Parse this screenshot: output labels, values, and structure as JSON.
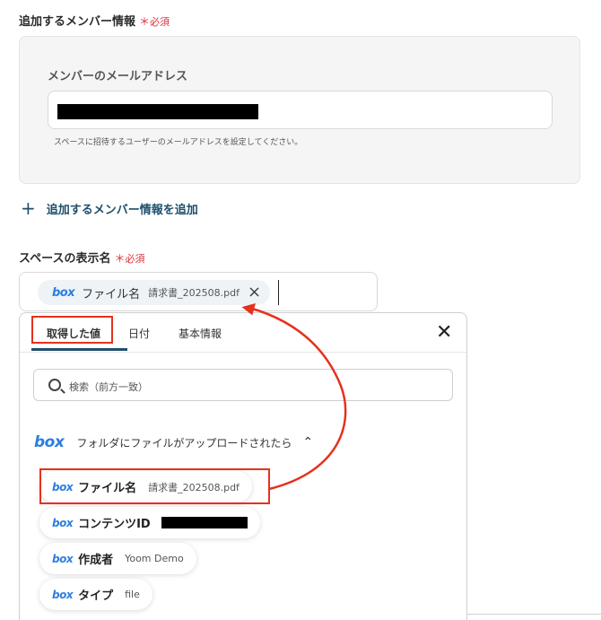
{
  "member_section": {
    "title": "追加するメンバー情報",
    "required_star": "＊",
    "required_label": "必須",
    "email_label": "メンバーのメールアドレス",
    "email_hint": "スペースに招待するユーザーのメールアドレスを設定してください。",
    "add_button_icon": "plus-icon",
    "add_button_label": "追加するメンバー情報を追加"
  },
  "display_name": {
    "title": "スペースの表示名",
    "required_star": "＊",
    "required_label": "必須",
    "chip": {
      "icon": "box-logo",
      "logo_text": "box",
      "name": "ファイル名",
      "value": "請求書_202508.pdf",
      "remove_icon": "close-icon"
    }
  },
  "dropdown": {
    "tabs": [
      "取得した値",
      "日付",
      "基本情報"
    ],
    "active_tab": "取得した値",
    "search_placeholder": "検索（前方一致）",
    "trigger": {
      "logo_text": "box",
      "label": "フォルダにファイルがアップロードされたら",
      "chevron": "⌃"
    },
    "items": [
      {
        "logo_text": "box",
        "name": "ファイル名",
        "value": "請求書_202508.pdf"
      },
      {
        "logo_text": "box",
        "name": "コンテンツID",
        "value": ""
      },
      {
        "logo_text": "box",
        "name": "作成者",
        "value": "Yoom Demo"
      },
      {
        "logo_text": "box",
        "name": "タイプ",
        "value": "file"
      }
    ]
  },
  "colors": {
    "accent": "#1f4f6b",
    "required": "#e0303a",
    "highlight": "#e4321c",
    "box_brand": "#2d7de0"
  }
}
